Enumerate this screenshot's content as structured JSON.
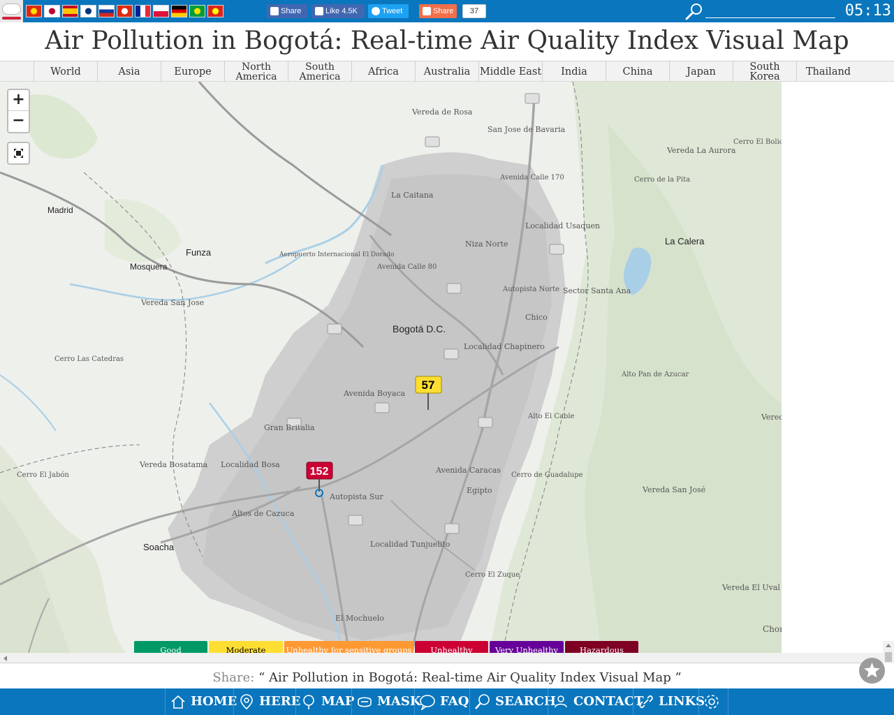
{
  "topbar": {
    "flags": [
      {
        "name": "china-flag",
        "colors": [
          "#de2910",
          "#ffde00"
        ]
      },
      {
        "name": "japan-flag",
        "colors": [
          "#ffffff",
          "#bc002d"
        ]
      },
      {
        "name": "spain-flag",
        "colors": [
          "#c60b1e",
          "#ffc400"
        ]
      },
      {
        "name": "korea-flag",
        "colors": [
          "#ffffff",
          "#003478"
        ]
      },
      {
        "name": "russia-flag",
        "colors": [
          "#ffffff",
          "#0039a6",
          "#d52b1e"
        ]
      },
      {
        "name": "hongkong-flag",
        "colors": [
          "#de2910",
          "#ffffff"
        ]
      },
      {
        "name": "france-flag",
        "colors": [
          "#002395",
          "#ffffff",
          "#ed2939"
        ]
      },
      {
        "name": "poland-flag",
        "colors": [
          "#ffffff",
          "#dc143c"
        ]
      },
      {
        "name": "germany-flag",
        "colors": [
          "#000000",
          "#dd0000",
          "#ffce00"
        ]
      },
      {
        "name": "brazil-flag",
        "colors": [
          "#009c3b",
          "#ffdf00"
        ]
      },
      {
        "name": "vietnam-flag",
        "colors": [
          "#da251d",
          "#ffff00"
        ]
      }
    ],
    "fb_share_label": "Share",
    "fb_like_label": "Like 4.5K",
    "tweet_label": "Tweet",
    "share_label": "Share",
    "share_count": "37",
    "search_value": "",
    "clock": "05:13"
  },
  "title": "Air Pollution in Bogotá: Real-time Air Quality Index Visual Map",
  "regions": [
    "World",
    "Asia",
    "Europe",
    "North\nAmerica",
    "South\nAmerica",
    "Africa",
    "Australia",
    "Middle East",
    "India",
    "China",
    "Japan",
    "South Korea",
    "Thailand"
  ],
  "map": {
    "zoom_in": "+",
    "zoom_out": "−",
    "labels": [
      "Bogotá D.C.",
      "Madrid",
      "Funza",
      "Mosquera",
      "Soacha",
      "La Calera",
      "La Caitana",
      "Localidad Usaquen",
      "Niza Norte",
      "Chico",
      "Sector Santa Ana",
      "Localidad Chapinero",
      "Gran Britalia",
      "Localidad Bosa",
      "Altos de Cazuca",
      "Localidad Tunjuelito",
      "Cerro El Zuque",
      "El Mochuelo",
      "Vereda de Rosa",
      "San Jose de Bavaria",
      "Vereda La Aurora",
      "Cerro El Boliche",
      "Cerro de la Pita",
      "Aeropuerto Internacional El Dorado",
      "Vereda San Jose",
      "Cerro Las Catedras",
      "Vereda Bosatama",
      "Cerro El Jabón",
      "Alto Pan de Azucar",
      "Alto El Cable",
      "Cerro de Guadalupe",
      "Vereda San José",
      "Vereda El Uval",
      "Egipto",
      "Avenida Calle 80",
      "Autopista Sur",
      "Avenida Boyaca",
      "Avenida Caracas",
      "Avenida Calle 170",
      "Autopista Norte",
      "Vereda La Ju",
      "Chorr"
    ],
    "markers": [
      {
        "value": "57",
        "level": "moderate"
      },
      {
        "value": "152",
        "level": "unhealthy"
      }
    ]
  },
  "legend": [
    {
      "label": "Good",
      "color": "#009966",
      "text": "#ffffff"
    },
    {
      "label": "Moderate",
      "color": "#ffde33",
      "text": "#000000"
    },
    {
      "label": "Unhealthy for sensitive groups",
      "color": "#ff9933",
      "text": "#ffffff"
    },
    {
      "label": "Unhealthy",
      "color": "#cc0033",
      "text": "#ffffff"
    },
    {
      "label": "Very Unhealthy",
      "color": "#660099",
      "text": "#ffffff"
    },
    {
      "label": "Hazardous",
      "color": "#7e0023",
      "text": "#ffffff"
    }
  ],
  "share_line": {
    "label": "Share:",
    "quote_open": "“",
    "text": "Air Pollution in Bogotá: Real-time Air Quality Index Visual Map",
    "quote_close": "”"
  },
  "bottom_nav": [
    {
      "label": "HOME",
      "icon": "home-icon"
    },
    {
      "label": "HERE",
      "icon": "location-pin-icon"
    },
    {
      "label": "MAP",
      "icon": "map-search-icon"
    },
    {
      "label": "MASK",
      "icon": "mask-icon"
    },
    {
      "label": "FAQ",
      "icon": "faq-icon"
    },
    {
      "label": "SEARCH",
      "icon": "search-icon"
    },
    {
      "label": "CONTACT",
      "icon": "contact-icon"
    },
    {
      "label": "LINKS",
      "icon": "link-icon"
    },
    {
      "label": "",
      "icon": "settings-icon"
    }
  ],
  "colors": {
    "brand_blue": "#0a76bd",
    "marker_moderate": "#ffde33",
    "marker_unhealthy": "#cc0033"
  }
}
